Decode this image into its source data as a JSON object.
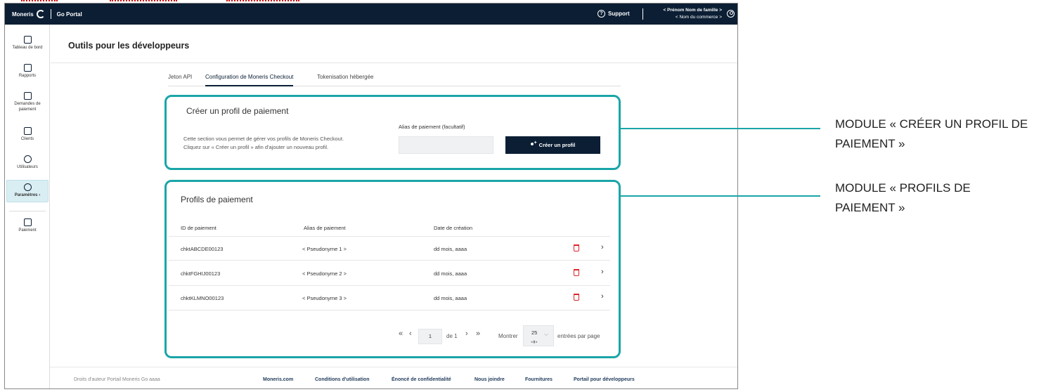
{
  "topbar": {
    "brand": "Moneris",
    "product_bold": "Go",
    "product": "Portal",
    "support": "Support",
    "user_name": "< Prénom Nom de famille >",
    "merchant_name": "< Nom du commerce >"
  },
  "sidebar": {
    "items": [
      {
        "label": "Tableau de bord"
      },
      {
        "label": "Rapports"
      },
      {
        "label": "Demandes de paiement"
      },
      {
        "label": "Clients"
      },
      {
        "label": "Utilisateurs"
      },
      {
        "label": "Paramètres",
        "suffix": "›"
      },
      {
        "label": "Paiement"
      }
    ]
  },
  "page": {
    "title": "Outils pour les développeurs",
    "tabs": [
      "Jeton API",
      "Configuration de Moneris Checkout",
      "Tokenisation hébergée"
    ],
    "active_tab": "Configuration de Moneris Checkout"
  },
  "create_profile": {
    "title": "Créer un profil de paiement",
    "description_line1": "Cette section vous permet de gérer vos profils de Moneris Checkout.",
    "description_line2": "Cliquez sur « Créer un profil » afin d'ajouter un nouveau profil.",
    "alias_label": "Alias de paiement (facultatif)",
    "alias_value": "",
    "button_label": "Créer un profil"
  },
  "profiles": {
    "title": "Profils de paiement",
    "columns": [
      "ID de paiement",
      "Alias de paiement",
      "Date de création"
    ],
    "rows": [
      {
        "id": "chktABCDE00123",
        "alias": "< Pseudonyme 1 >",
        "date": "dd mois, aaaa"
      },
      {
        "id": "chktFGHIJ00123",
        "alias": "< Pseudonyme 2 >",
        "date": "dd mois, aaaa"
      },
      {
        "id": "chktKLMNO00123",
        "alias": "< Pseudonyme 3 >",
        "date": "dd mois, aaaa"
      }
    ],
    "pagination": {
      "first": "«",
      "prev": "‹",
      "page": "1",
      "of": "de 1",
      "next": "›",
      "last": "»",
      "show_label": "Montrer",
      "per_page": "25",
      "per_page_suffix": "entrées par page"
    }
  },
  "footer": {
    "copyright": "Droits d'auteur Portail Moneris Go  aaaa",
    "links": [
      "Moneris.com",
      "Conditions d'utilisation",
      "Énoncé de confidentialité",
      "Nous joindre",
      "Fournitures",
      "Portail pour développeurs"
    ]
  },
  "callouts": {
    "create_module_line1": "MODULE « CRÉER UN PROFIL DE",
    "create_module_line2": "PAIEMENT »",
    "profiles_module_line1": "MODULE « PROFILS DE",
    "profiles_module_line2": "PAIEMENT »"
  },
  "colors": {
    "topbar_bg": "#0b1e34",
    "accent_teal": "#1aa5a8",
    "delete_red": "#d9262b",
    "active_nav_bg": "#d9eef3"
  }
}
